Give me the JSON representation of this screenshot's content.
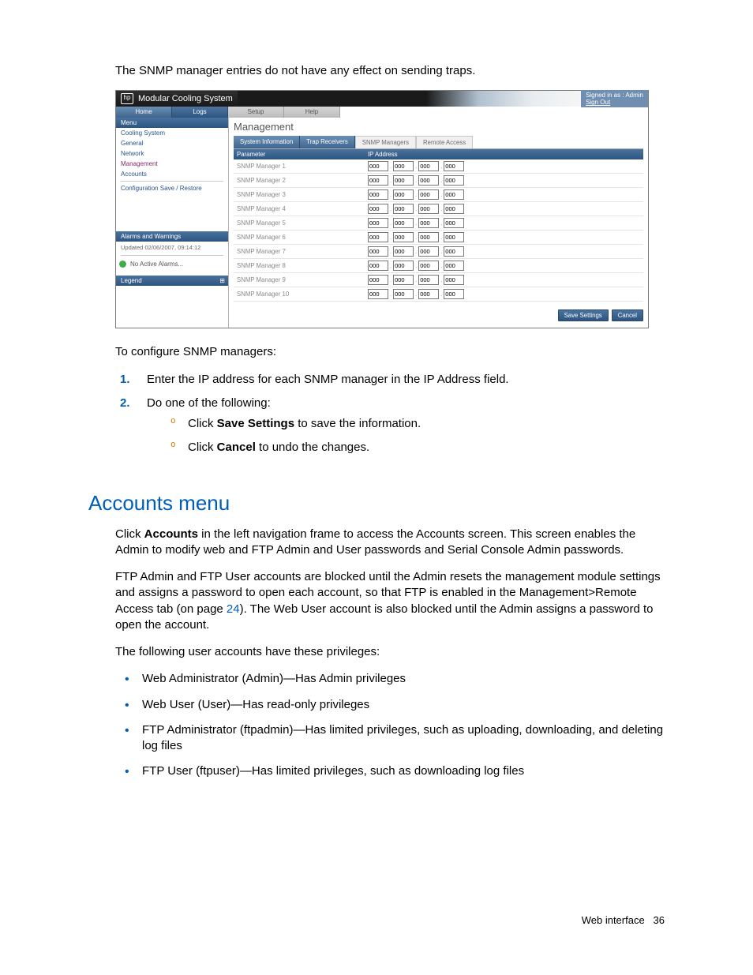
{
  "intro_line": "The SNMP manager entries do not have any effect on sending traps.",
  "screenshot": {
    "app_title": "Modular Cooling System",
    "signin": {
      "line1": "Signed in as : Admin",
      "signout": "Sign Out"
    },
    "top_tabs": [
      "Home",
      "Logs",
      "Setup",
      "Help"
    ],
    "top_tabs_selected_index": 1,
    "side": {
      "menu_label": "Menu",
      "items": [
        "Cooling System",
        "General",
        "Network",
        "Management",
        "Accounts",
        "Configuration Save / Restore"
      ],
      "selected_index": 3,
      "alarms_label": "Alarms and Warnings",
      "updated": "Updated 02/06/2007, 09:14:12",
      "no_alarms": "No Active Alarms...",
      "legend_label": "Legend"
    },
    "main": {
      "title": "Management",
      "tabs": [
        "System Information",
        "Trap Receivers",
        "SNMP Managers",
        "Remote Access"
      ],
      "tabs_selected_index": 2,
      "col_param": "Parameter",
      "col_ip": "IP Address",
      "rows": [
        {
          "label": "SNMP Manager 1",
          "ip": [
            "000",
            "000",
            "000",
            "000"
          ]
        },
        {
          "label": "SNMP Manager 2",
          "ip": [
            "000",
            "000",
            "000",
            "000"
          ]
        },
        {
          "label": "SNMP Manager 3",
          "ip": [
            "000",
            "000",
            "000",
            "000"
          ]
        },
        {
          "label": "SNMP Manager 4",
          "ip": [
            "000",
            "000",
            "000",
            "000"
          ]
        },
        {
          "label": "SNMP Manager 5",
          "ip": [
            "000",
            "000",
            "000",
            "000"
          ]
        },
        {
          "label": "SNMP Manager 6",
          "ip": [
            "000",
            "000",
            "000",
            "000"
          ]
        },
        {
          "label": "SNMP Manager 7",
          "ip": [
            "000",
            "000",
            "000",
            "000"
          ]
        },
        {
          "label": "SNMP Manager 8",
          "ip": [
            "000",
            "000",
            "000",
            "000"
          ]
        },
        {
          "label": "SNMP Manager 9",
          "ip": [
            "000",
            "000",
            "000",
            "000"
          ]
        },
        {
          "label": "SNMP Manager 10",
          "ip": [
            "000",
            "000",
            "000",
            "000"
          ]
        }
      ],
      "save_btn": "Save Settings",
      "cancel_btn": "Cancel"
    }
  },
  "configure_heading": "To configure SNMP managers:",
  "steps": {
    "s1": "Enter the IP address for each SNMP manager in the IP Address field.",
    "s2": "Do one of the following:",
    "s2a_pre": "Click ",
    "s2a_b": "Save Settings",
    "s2a_post": " to save the information.",
    "s2b_pre": "Click ",
    "s2b_b": "Cancel",
    "s2b_post": " to undo the changes."
  },
  "section_title": "Accounts menu",
  "para1_pre": "Click ",
  "para1_b": "Accounts",
  "para1_post": " in the left navigation frame to access the Accounts screen. This screen enables the Admin to modify web and FTP Admin and User passwords and Serial Console Admin passwords.",
  "para2_a": "FTP Admin and FTP User accounts are blocked until the Admin resets the management module settings and assigns a password to open each account, so that FTP is enabled in the Management>Remote Access tab (on page ",
  "para2_link": "24",
  "para2_b": "). The Web User account is also blocked until the Admin assigns a password to open the account.",
  "para3": "The following user accounts have these privileges:",
  "privs": [
    "Web Administrator (Admin)—Has Admin privileges",
    "Web User (User)—Has read-only privileges",
    "FTP Administrator (ftpadmin)—Has limited privileges, such as uploading, downloading, and deleting log files",
    "FTP User (ftpuser)—Has limited privileges, such as downloading log files"
  ],
  "footer_label": "Web interface",
  "footer_page": "36"
}
